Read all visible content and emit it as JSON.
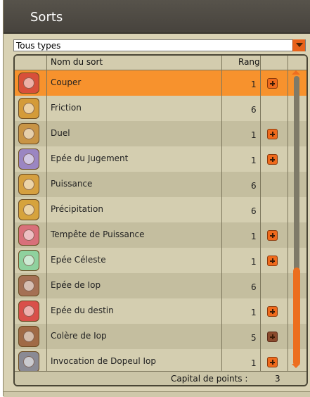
{
  "window": {
    "title": "Sorts"
  },
  "filter": {
    "selected": "Tous types"
  },
  "table": {
    "headers": {
      "name": "Nom du sort",
      "rank": "Rang"
    },
    "rows": [
      {
        "name": "Couper",
        "rank": "1",
        "upgradable": true,
        "icon": "warning-icon",
        "color": "#d8503a",
        "selected": true
      },
      {
        "name": "Friction",
        "rank": "6",
        "upgradable": false,
        "icon": "friction-icon",
        "color": "#d49b39",
        "selected": false
      },
      {
        "name": "Duel",
        "rank": "1",
        "upgradable": true,
        "icon": "duel-icon",
        "color": "#c89445",
        "selected": false
      },
      {
        "name": "Epée du Jugement",
        "rank": "1",
        "upgradable": true,
        "icon": "judgement-icon",
        "color": "#9b86c2",
        "selected": false
      },
      {
        "name": "Puissance",
        "rank": "6",
        "upgradable": false,
        "icon": "power-icon",
        "color": "#d5a040",
        "selected": false
      },
      {
        "name": "Précipitation",
        "rank": "6",
        "upgradable": false,
        "icon": "haste-icon",
        "color": "#d6a33d",
        "selected": false
      },
      {
        "name": "Tempête de Puissance",
        "rank": "1",
        "upgradable": true,
        "icon": "storm-icon",
        "color": "#d8707a",
        "selected": false
      },
      {
        "name": "Epée Céleste",
        "rank": "1",
        "upgradable": true,
        "icon": "celestial-sword-icon",
        "color": "#8fd19e",
        "selected": false
      },
      {
        "name": "Epée de Iop",
        "rank": "6",
        "upgradable": false,
        "icon": "iop-sword-icon",
        "color": "#a47054",
        "selected": false
      },
      {
        "name": "Epée du destin",
        "rank": "1",
        "upgradable": true,
        "icon": "destiny-sword-icon",
        "color": "#d9504a",
        "selected": false
      },
      {
        "name": "Colère de Iop",
        "rank": "5",
        "upgradable": true,
        "plus_disabled": true,
        "icon": "wrath-icon",
        "color": "#a06a46",
        "selected": false
      },
      {
        "name": "Invocation de Dopeul Iop",
        "rank": "1",
        "upgradable": true,
        "icon": "summon-icon",
        "color": "#8a8a94",
        "selected": false
      }
    ]
  },
  "footer": {
    "label": "Capital de points :",
    "value": "3"
  },
  "colors": {
    "accent": "#ef6a1c",
    "selected_row": "#f7922d",
    "titlebar": "#4d4a43"
  }
}
